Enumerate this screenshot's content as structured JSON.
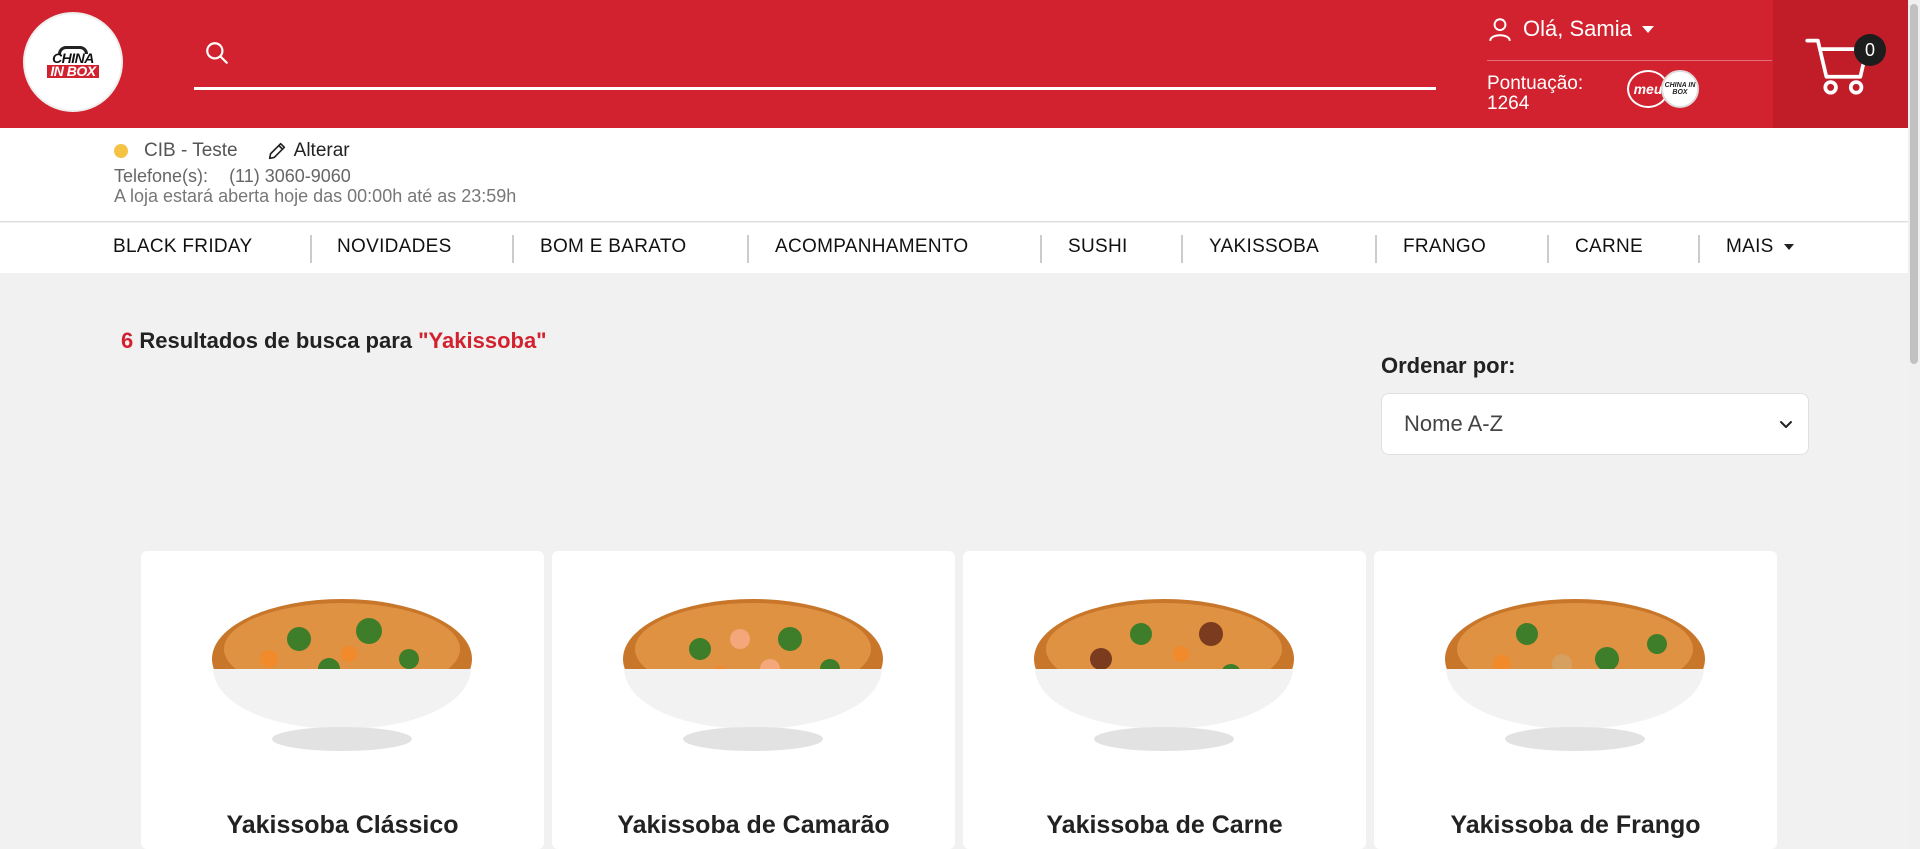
{
  "header": {
    "logo_text_line1": "CHINA",
    "logo_text_line2": "IN BOX",
    "search": {
      "value": "",
      "placeholder": ""
    },
    "user": {
      "greeting": "Olá, Samia"
    },
    "points": {
      "label": "Pontuação:",
      "value": "1264"
    },
    "badge": {
      "meu": "meu",
      "china": "CHINA IN BOX"
    },
    "cart": {
      "count": "0"
    }
  },
  "store": {
    "name": "CIB - Teste",
    "change_label": "Alterar",
    "phone_label": "Telefone(s):",
    "phone": "(11) 3060-9060",
    "hours": "A loja estará aberta hoje das 00:00h até as 23:59h",
    "status_color": "#f6c244"
  },
  "nav": {
    "items": [
      "BLACK FRIDAY",
      "NOVIDADES",
      "BOM E BARATO",
      "ACOMPANHAMENTO",
      "SUSHI",
      "YAKISSOBA",
      "FRANGO",
      "CARNE"
    ],
    "more_label": "MAIS"
  },
  "results": {
    "count": "6",
    "text": " Resultados de busca para ",
    "term": "\"Yakissoba\""
  },
  "sort": {
    "label": "Ordenar por:",
    "selected": "Nome A-Z"
  },
  "products": [
    {
      "name": "Yakissoba Clássico"
    },
    {
      "name": "Yakissoba de Camarão"
    },
    {
      "name": "Yakissoba de Carne"
    },
    {
      "name": "Yakissoba de Frango"
    }
  ],
  "colors": {
    "brand_red": "#d3222f",
    "cart_red": "#c01d29",
    "background": "#f1f1f1"
  }
}
